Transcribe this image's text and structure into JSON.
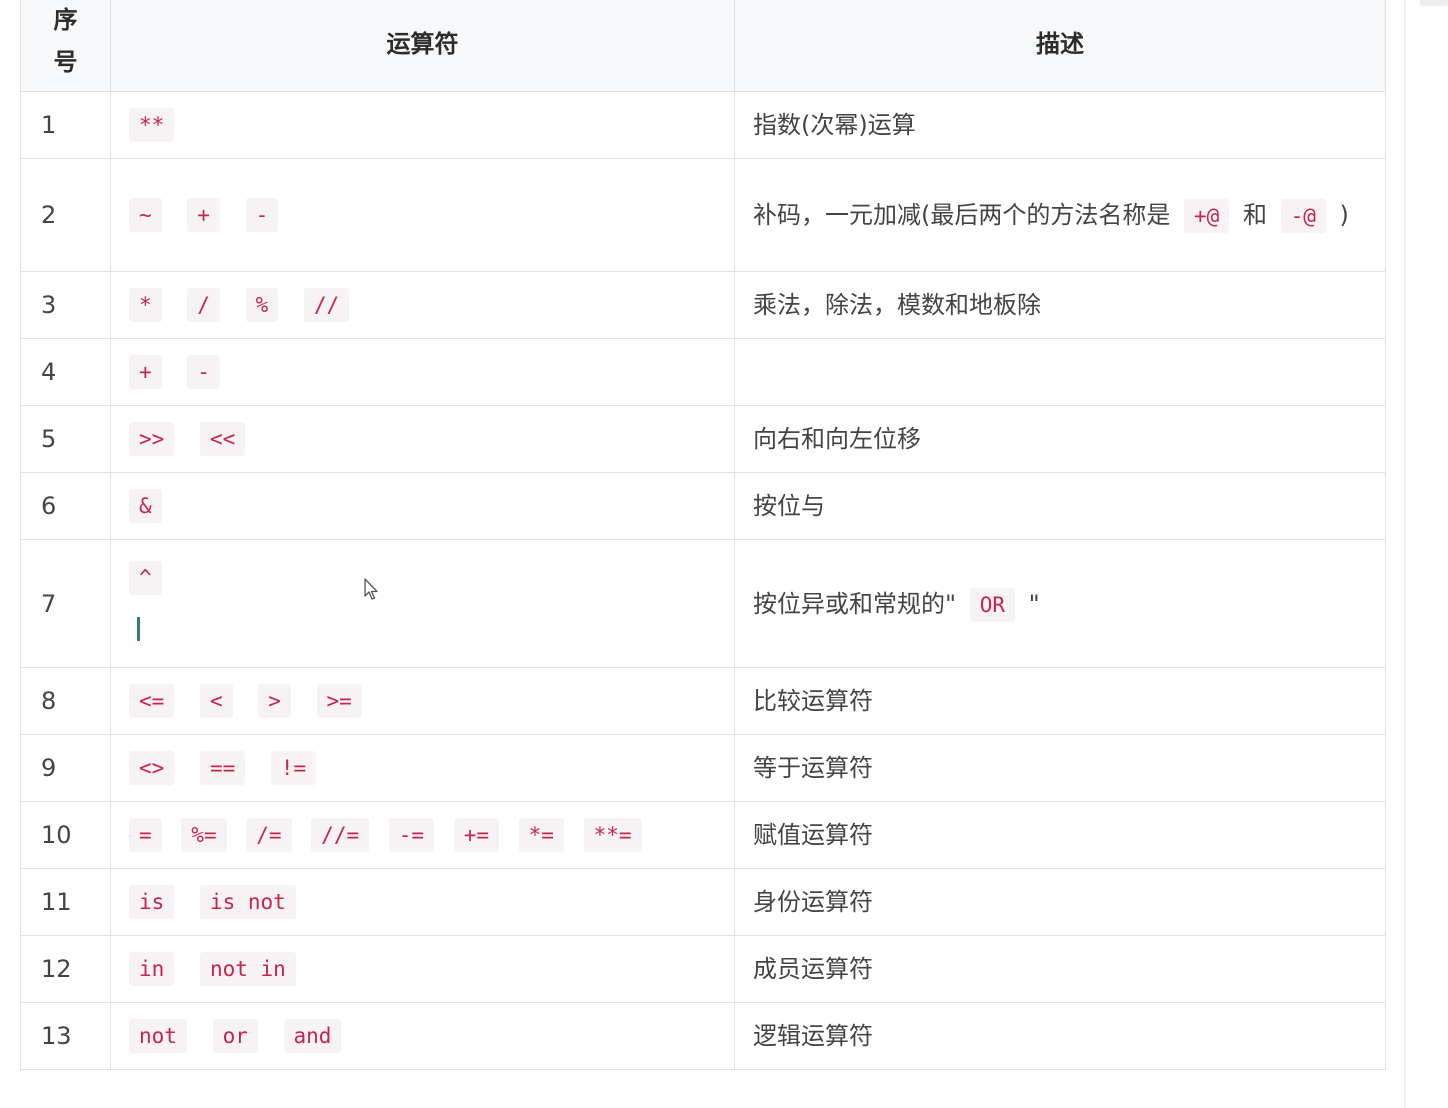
{
  "table": {
    "headers": {
      "num_line1": "序",
      "num_line2": "号",
      "operator": "运算符",
      "description": "描述"
    },
    "rows": [
      {
        "num": "1",
        "ops": [
          "**"
        ],
        "desc": "指数(次幂)运算"
      },
      {
        "num": "2",
        "ops": [
          "~",
          "+",
          "-"
        ],
        "desc_before": "补码，一元加减(最后两个的方法名称是",
        "desc_code1": "+@",
        "desc_mid": "和",
        "desc_code2": "-@",
        "desc_after": ")"
      },
      {
        "num": "3",
        "ops": [
          "*",
          "/",
          "%",
          "//"
        ],
        "desc": "乘法，除法，模数和地板除"
      },
      {
        "num": "4",
        "ops": [
          "+",
          "-"
        ],
        "desc": ""
      },
      {
        "num": "5",
        "ops": [
          ">>",
          "<<"
        ],
        "desc": "向右和向左位移"
      },
      {
        "num": "6",
        "ops": [
          "&"
        ],
        "desc": "按位与"
      },
      {
        "num": "7",
        "ops": [
          "^"
        ],
        "desc_before": "按位异或和常规的\"",
        "desc_code": "OR",
        "desc_after": "\""
      },
      {
        "num": "8",
        "ops": [
          "<=",
          "<",
          ">",
          ">="
        ],
        "desc": "比较运算符"
      },
      {
        "num": "9",
        "ops": [
          "<>",
          "==",
          "!="
        ],
        "desc": "等于运算符"
      },
      {
        "num": "10",
        "ops": [
          "=",
          "%=",
          "/=",
          "//=",
          "-=",
          "+=",
          "*=",
          "**="
        ],
        "desc": "赋值运算符"
      },
      {
        "num": "11",
        "ops": [
          "is",
          "is not"
        ],
        "desc": "身份运算符"
      },
      {
        "num": "12",
        "ops": [
          "in",
          "not in"
        ],
        "desc": "成员运算符"
      },
      {
        "num": "13",
        "ops": [
          "not",
          "or",
          "and"
        ],
        "desc": "逻辑运算符"
      }
    ]
  },
  "icons": {
    "cursor": "mouse-pointer-icon"
  }
}
